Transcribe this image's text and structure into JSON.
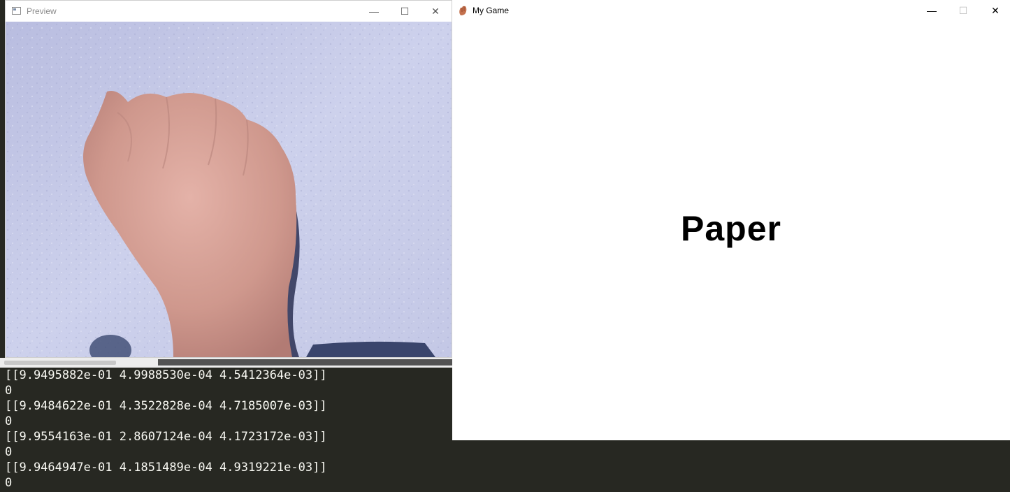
{
  "terminal": {
    "lines": [
      "[[9.9495882e-01 4.9988530e-04 4.5412364e-03]]",
      "0",
      "[[9.9484622e-01 4.3522828e-04 4.7185007e-03]]",
      "0",
      "[[9.9554163e-01 2.8607124e-04 4.1723172e-03]]",
      "0",
      "[[9.9464947e-01 4.1851489e-04 4.9319221e-03]]",
      "0"
    ]
  },
  "preview_window": {
    "title": "Preview",
    "minimize_glyph": "—",
    "maximize_glyph": "☐",
    "close_glyph": "✕",
    "icon": "window-app-icon"
  },
  "game_window": {
    "title": "My Game",
    "icon": "hand-icon",
    "minimize_glyph": "—",
    "maximize_glyph": "☐",
    "close_glyph": "✕",
    "prediction": "Paper"
  },
  "colors": {
    "terminal_bg": "#272822",
    "terminal_fg": "#f8f8f2",
    "wall": "#c9cde8",
    "skin": "#d9a79c"
  }
}
